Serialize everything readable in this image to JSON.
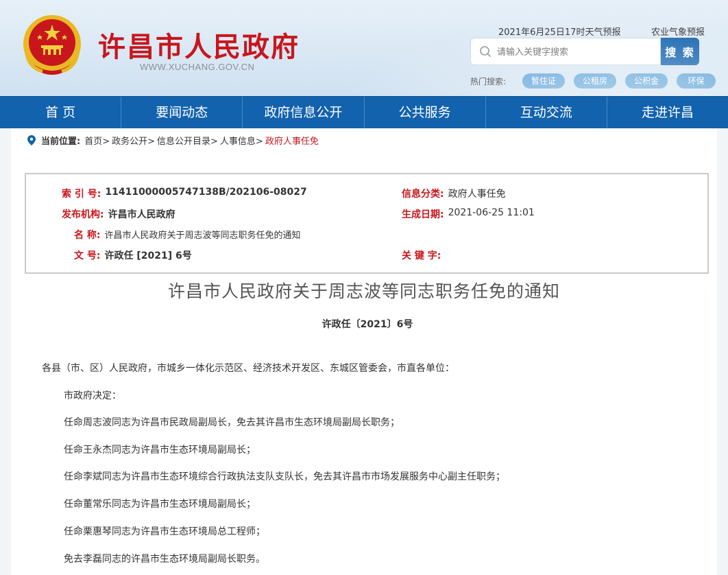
{
  "header": {
    "title": "许昌市人民政府",
    "url": "WWW.XUCHANG.GOV.CN",
    "weather": "2021年6月25日17时天气预报",
    "agri_weather": "农业气象预报",
    "search_placeholder": "请输入关键字搜索",
    "search_button": "搜 索",
    "hot_label": "热门搜索:",
    "hot_tags": [
      "暂住证",
      "公租房",
      "公积金",
      "环保"
    ]
  },
  "nav": [
    "首 页",
    "要闻动态",
    "政府信息公开",
    "公共服务",
    "互动交流",
    "走进许昌"
  ],
  "breadcrumb": {
    "label": "当前位置:",
    "items": [
      "首页>",
      "政务公开>",
      "信息公开目录>",
      "人事信息>"
    ],
    "current": "政府人事任免"
  },
  "meta": {
    "index_key": "索 引 号:",
    "index_val": "11411000005747138B/202106-08027",
    "category_key": "信息分类:",
    "category_val": "政府人事任免",
    "publisher_key": "发布机构:",
    "publisher_val": "许昌市人民政府",
    "date_key": "生成日期:",
    "date_val": "2021-06-25 11:01",
    "name_key": "名 称:",
    "name_val": "许昌市人民政府关于周志波等同志职务任免的通知",
    "docno_key": "文 号:",
    "docno_val": "许政任 [2021] 6号",
    "keyword_key": "关 键 字:"
  },
  "document": {
    "title": "许昌市人民政府关于周志波等同志职务任免的通知",
    "number": "许政任〔2021〕6号",
    "paragraphs": [
      "各县（市、区）人民政府，市城乡一体化示范区、经济技术开发区、东城区管委会，市直各单位：",
      "市政府决定：",
      "任命周志波同志为许昌市民政局副局长，免去其许昌市生态环境局副局长职务；",
      "任命王永杰同志为许昌市生态环境局副局长；",
      "任命李斌同志为许昌市生态环境综合行政执法支队支队长，免去其许昌市市场发展服务中心副主任职务；",
      "任命董常乐同志为许昌市生态环境局副局长；",
      "任命栗惠琴同志为许昌市生态环境局总工程师；",
      "免去李磊同志的许昌市生态环境局副局长职务。"
    ]
  },
  "colors": {
    "brand_red": "#c8161d",
    "nav_blue": "#1262ad",
    "tag_blue": "#5aa0d8"
  }
}
